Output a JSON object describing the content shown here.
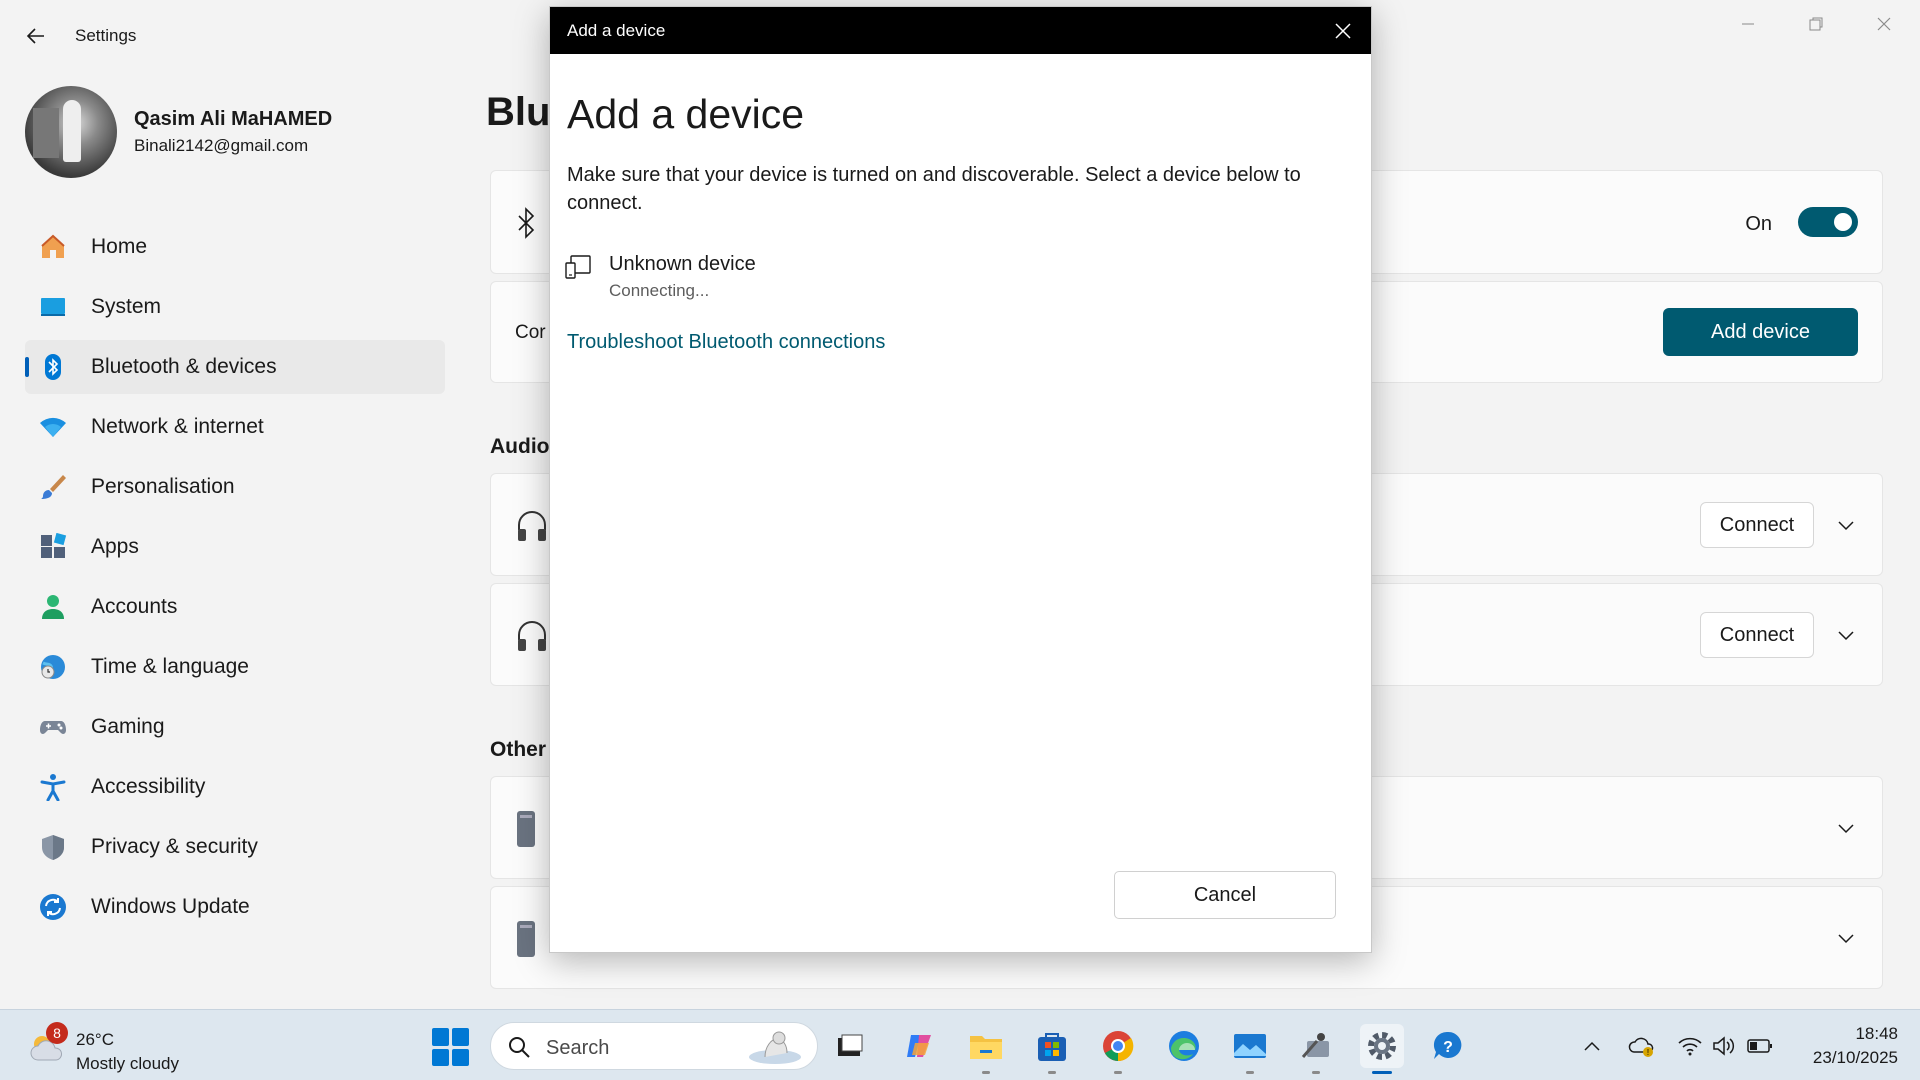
{
  "window": {
    "app_title": "Settings"
  },
  "profile": {
    "name": "Qasim Ali MaHAMED",
    "email": "Binali2142@gmail.com"
  },
  "sidebar": {
    "items": [
      {
        "label": "Home",
        "icon": "home-icon"
      },
      {
        "label": "System",
        "icon": "system-icon"
      },
      {
        "label": "Bluetooth & devices",
        "icon": "bluetooth-icon",
        "active": true
      },
      {
        "label": "Network & internet",
        "icon": "wifi-icon"
      },
      {
        "label": "Personalisation",
        "icon": "brush-icon"
      },
      {
        "label": "Apps",
        "icon": "apps-icon"
      },
      {
        "label": "Accounts",
        "icon": "person-icon"
      },
      {
        "label": "Time & language",
        "icon": "globe-clock-icon"
      },
      {
        "label": "Gaming",
        "icon": "gamepad-icon"
      },
      {
        "label": "Accessibility",
        "icon": "accessibility-icon"
      },
      {
        "label": "Privacy & security",
        "icon": "shield-icon"
      },
      {
        "label": "Windows Update",
        "icon": "update-icon"
      }
    ]
  },
  "main": {
    "page_title": "Blu",
    "bluetooth_toggle_label": "On",
    "connect_card_label": "Cor",
    "add_device_button": "Add device",
    "audio_section_title": "Audio",
    "audio_connect_1": "Connect",
    "audio_connect_2": "Connect",
    "other_section_title": "Other"
  },
  "dialog": {
    "titlebar": "Add a device",
    "heading": "Add a device",
    "description": "Make sure that your device is turned on and discoverable. Select a device below to connect.",
    "device_name": "Unknown device",
    "device_status": "Connecting...",
    "troubleshoot_link": "Troubleshoot Bluetooth connections",
    "cancel_button": "Cancel"
  },
  "taskbar": {
    "weather_badge": "8",
    "weather_temp": "26°C",
    "weather_desc": "Mostly cloudy",
    "search_placeholder": "Search",
    "time": "18:48",
    "date": "23/10/2025"
  },
  "colors": {
    "accent": "#005a70",
    "sidebar_accent": "#005fb8",
    "dialog_titlebar": "#000000",
    "taskbar_bg": "#dde7ef"
  }
}
